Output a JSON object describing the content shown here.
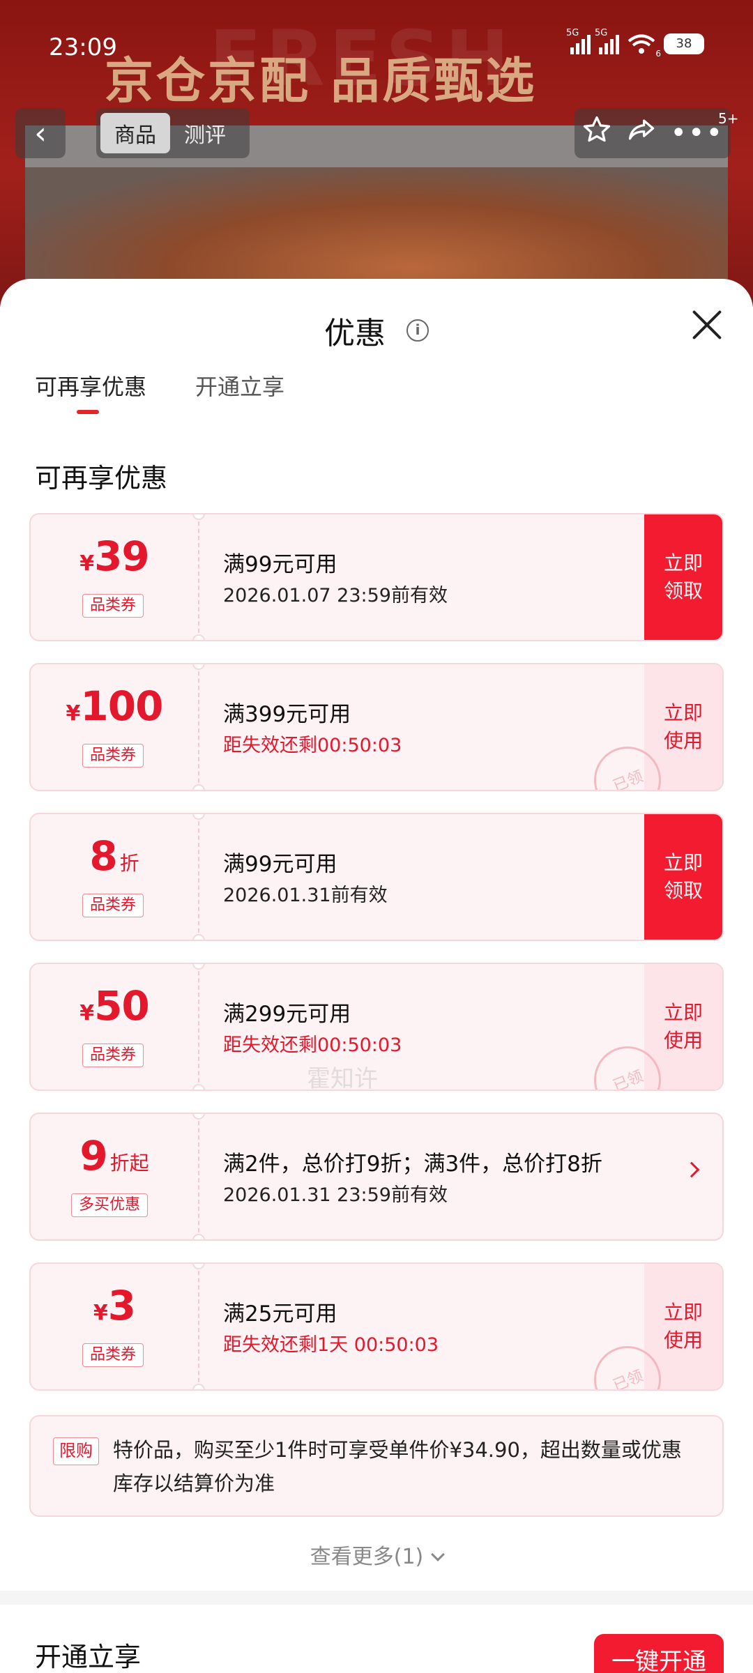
{
  "status_bar": {
    "time": "23:09",
    "network_1": "5G",
    "network_2": "5G",
    "wifi_sub": "6",
    "battery": "38"
  },
  "background": {
    "banner": "京仓京配 品质甄选",
    "banner_bg_word": "FRESH",
    "tabs": [
      "商品",
      "测评"
    ],
    "more_badge": "5+"
  },
  "sheet": {
    "title": "优惠",
    "tabs": [
      {
        "label": "可再享优惠",
        "active": true
      },
      {
        "label": "开通立享",
        "active": false
      }
    ],
    "section_title": "可再享优惠",
    "coupons": [
      {
        "currency": "¥",
        "amount": "39",
        "suffix": "",
        "tag": "品类券",
        "title": "满99元可用",
        "subtitle": "2026.01.07 23:59前有效",
        "subtitle_red": false,
        "action": "立即领取",
        "claimed_stamp": ""
      },
      {
        "currency": "¥",
        "amount": "100",
        "suffix": "",
        "tag": "品类券",
        "title": "满399元可用",
        "subtitle": "距失效还剩00:50:03",
        "subtitle_red": true,
        "action": "立即使用",
        "claimed_stamp": "已领"
      },
      {
        "currency": "",
        "amount": "8",
        "suffix": "折",
        "tag": "品类券",
        "title": "满99元可用",
        "subtitle": "2026.01.31前有效",
        "subtitle_red": false,
        "action": "立即领取",
        "claimed_stamp": ""
      },
      {
        "currency": "¥",
        "amount": "50",
        "suffix": "",
        "tag": "品类券",
        "title": "满299元可用",
        "subtitle": "距失效还剩00:50:03",
        "subtitle_red": true,
        "action": "立即使用",
        "claimed_stamp": "已领"
      },
      {
        "currency": "",
        "amount": "9",
        "suffix": "折起",
        "tag": "多买优惠",
        "title": "满2件，总价打9折；满3件，总价打8折",
        "subtitle": "2026.01.31 23:59前有效",
        "subtitle_red": false,
        "action": "",
        "claimed_stamp": ""
      },
      {
        "currency": "¥",
        "amount": "3",
        "suffix": "",
        "tag": "品类券",
        "title": "满25元可用",
        "subtitle": "距失效还剩1天 00:50:03",
        "subtitle_red": true,
        "action": "立即使用",
        "claimed_stamp": "已领"
      }
    ],
    "watermark": "霍知许",
    "limit": {
      "tag": "限购",
      "text": "特价品，购买至少1件时可享受单件价¥34.90，超出数量或优惠库存以结算价为准"
    },
    "more": "查看更多(1)",
    "open_section_title": "开通立享",
    "open_button": "一键开通"
  },
  "colors": {
    "accent": "#f21b30",
    "coupon_bg": "#fdf3f4",
    "coupon_border": "#f6d7db",
    "use_bg": "#fde4e8"
  },
  "icons": [
    "back-icon",
    "star-icon",
    "share-icon",
    "more-icon",
    "info-icon",
    "close-icon",
    "chevron-right-icon",
    "chevron-down-icon"
  ]
}
